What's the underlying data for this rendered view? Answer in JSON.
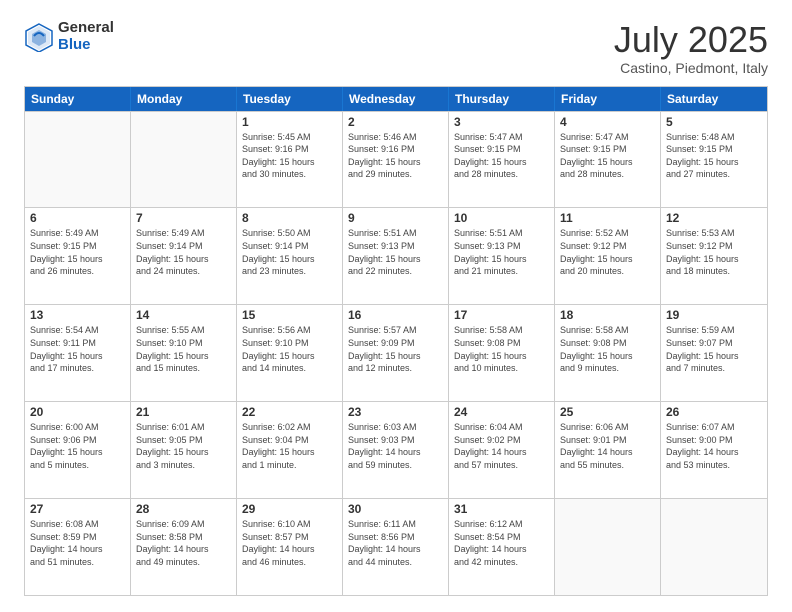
{
  "logo": {
    "general": "General",
    "blue": "Blue"
  },
  "title": "July 2025",
  "location": "Castino, Piedmont, Italy",
  "headers": [
    "Sunday",
    "Monday",
    "Tuesday",
    "Wednesday",
    "Thursday",
    "Friday",
    "Saturday"
  ],
  "weeks": [
    [
      {
        "day": "",
        "detail": ""
      },
      {
        "day": "",
        "detail": ""
      },
      {
        "day": "1",
        "detail": "Sunrise: 5:45 AM\nSunset: 9:16 PM\nDaylight: 15 hours\nand 30 minutes."
      },
      {
        "day": "2",
        "detail": "Sunrise: 5:46 AM\nSunset: 9:16 PM\nDaylight: 15 hours\nand 29 minutes."
      },
      {
        "day": "3",
        "detail": "Sunrise: 5:47 AM\nSunset: 9:15 PM\nDaylight: 15 hours\nand 28 minutes."
      },
      {
        "day": "4",
        "detail": "Sunrise: 5:47 AM\nSunset: 9:15 PM\nDaylight: 15 hours\nand 28 minutes."
      },
      {
        "day": "5",
        "detail": "Sunrise: 5:48 AM\nSunset: 9:15 PM\nDaylight: 15 hours\nand 27 minutes."
      }
    ],
    [
      {
        "day": "6",
        "detail": "Sunrise: 5:49 AM\nSunset: 9:15 PM\nDaylight: 15 hours\nand 26 minutes."
      },
      {
        "day": "7",
        "detail": "Sunrise: 5:49 AM\nSunset: 9:14 PM\nDaylight: 15 hours\nand 24 minutes."
      },
      {
        "day": "8",
        "detail": "Sunrise: 5:50 AM\nSunset: 9:14 PM\nDaylight: 15 hours\nand 23 minutes."
      },
      {
        "day": "9",
        "detail": "Sunrise: 5:51 AM\nSunset: 9:13 PM\nDaylight: 15 hours\nand 22 minutes."
      },
      {
        "day": "10",
        "detail": "Sunrise: 5:51 AM\nSunset: 9:13 PM\nDaylight: 15 hours\nand 21 minutes."
      },
      {
        "day": "11",
        "detail": "Sunrise: 5:52 AM\nSunset: 9:12 PM\nDaylight: 15 hours\nand 20 minutes."
      },
      {
        "day": "12",
        "detail": "Sunrise: 5:53 AM\nSunset: 9:12 PM\nDaylight: 15 hours\nand 18 minutes."
      }
    ],
    [
      {
        "day": "13",
        "detail": "Sunrise: 5:54 AM\nSunset: 9:11 PM\nDaylight: 15 hours\nand 17 minutes."
      },
      {
        "day": "14",
        "detail": "Sunrise: 5:55 AM\nSunset: 9:10 PM\nDaylight: 15 hours\nand 15 minutes."
      },
      {
        "day": "15",
        "detail": "Sunrise: 5:56 AM\nSunset: 9:10 PM\nDaylight: 15 hours\nand 14 minutes."
      },
      {
        "day": "16",
        "detail": "Sunrise: 5:57 AM\nSunset: 9:09 PM\nDaylight: 15 hours\nand 12 minutes."
      },
      {
        "day": "17",
        "detail": "Sunrise: 5:58 AM\nSunset: 9:08 PM\nDaylight: 15 hours\nand 10 minutes."
      },
      {
        "day": "18",
        "detail": "Sunrise: 5:58 AM\nSunset: 9:08 PM\nDaylight: 15 hours\nand 9 minutes."
      },
      {
        "day": "19",
        "detail": "Sunrise: 5:59 AM\nSunset: 9:07 PM\nDaylight: 15 hours\nand 7 minutes."
      }
    ],
    [
      {
        "day": "20",
        "detail": "Sunrise: 6:00 AM\nSunset: 9:06 PM\nDaylight: 15 hours\nand 5 minutes."
      },
      {
        "day": "21",
        "detail": "Sunrise: 6:01 AM\nSunset: 9:05 PM\nDaylight: 15 hours\nand 3 minutes."
      },
      {
        "day": "22",
        "detail": "Sunrise: 6:02 AM\nSunset: 9:04 PM\nDaylight: 15 hours\nand 1 minute."
      },
      {
        "day": "23",
        "detail": "Sunrise: 6:03 AM\nSunset: 9:03 PM\nDaylight: 14 hours\nand 59 minutes."
      },
      {
        "day": "24",
        "detail": "Sunrise: 6:04 AM\nSunset: 9:02 PM\nDaylight: 14 hours\nand 57 minutes."
      },
      {
        "day": "25",
        "detail": "Sunrise: 6:06 AM\nSunset: 9:01 PM\nDaylight: 14 hours\nand 55 minutes."
      },
      {
        "day": "26",
        "detail": "Sunrise: 6:07 AM\nSunset: 9:00 PM\nDaylight: 14 hours\nand 53 minutes."
      }
    ],
    [
      {
        "day": "27",
        "detail": "Sunrise: 6:08 AM\nSunset: 8:59 PM\nDaylight: 14 hours\nand 51 minutes."
      },
      {
        "day": "28",
        "detail": "Sunrise: 6:09 AM\nSunset: 8:58 PM\nDaylight: 14 hours\nand 49 minutes."
      },
      {
        "day": "29",
        "detail": "Sunrise: 6:10 AM\nSunset: 8:57 PM\nDaylight: 14 hours\nand 46 minutes."
      },
      {
        "day": "30",
        "detail": "Sunrise: 6:11 AM\nSunset: 8:56 PM\nDaylight: 14 hours\nand 44 minutes."
      },
      {
        "day": "31",
        "detail": "Sunrise: 6:12 AM\nSunset: 8:54 PM\nDaylight: 14 hours\nand 42 minutes."
      },
      {
        "day": "",
        "detail": ""
      },
      {
        "day": "",
        "detail": ""
      }
    ]
  ]
}
